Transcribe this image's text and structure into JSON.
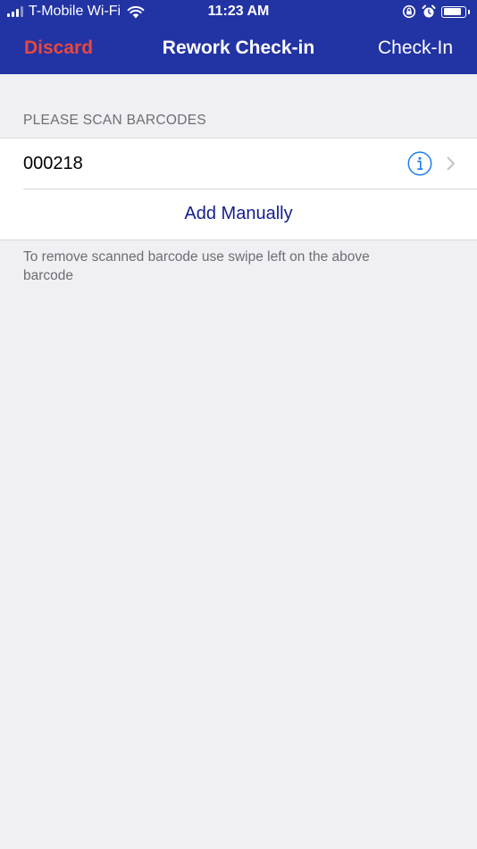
{
  "status_bar": {
    "carrier": "T-Mobile Wi-Fi",
    "time": "11:23 AM"
  },
  "nav": {
    "left_label": "Discard",
    "title": "Rework Check-in",
    "right_label": "Check-In"
  },
  "section": {
    "header": "PLEASE SCAN BARCODES"
  },
  "barcodes": [
    {
      "value": "000218"
    }
  ],
  "add_row": {
    "label": "Add Manually"
  },
  "footer_note": "To remove scanned barcode use swipe left on the above barcode",
  "colors": {
    "nav_background": "#2233a4",
    "discard": "#e8483f",
    "add_manually": "#141e8c",
    "info_icon": "#1a7cf2",
    "background": "#efeff4"
  },
  "icons": {
    "signal": "signal-icon",
    "wifi": "wifi-icon",
    "rotation_lock": "rotation-lock-icon",
    "alarm": "alarm-icon",
    "battery": "battery-icon",
    "info": "info-icon",
    "chevron": "chevron-right-icon"
  },
  "battery_level": 0.85
}
